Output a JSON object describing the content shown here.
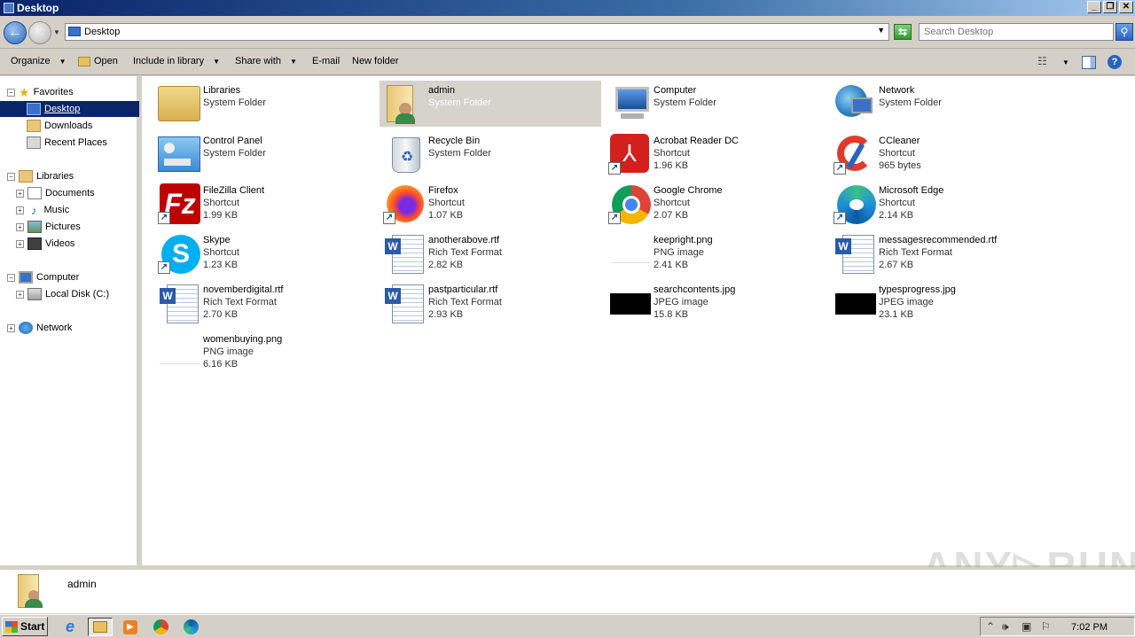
{
  "window": {
    "title": "Desktop"
  },
  "titlebar": {
    "minimize": "_",
    "maximize": "❐",
    "close": "✕"
  },
  "address": {
    "path": "Desktop",
    "search_placeholder": "Search Desktop"
  },
  "toolbar": {
    "organize": "Organize",
    "open": "Open",
    "include_in_library": "Include in library",
    "share_with": "Share with",
    "email": "E-mail",
    "new_folder": "New folder"
  },
  "nav": {
    "favorites": "Favorites",
    "desktop": "Desktop",
    "downloads": "Downloads",
    "recent_places": "Recent Places",
    "libraries": "Libraries",
    "documents": "Documents",
    "music": "Music",
    "pictures": "Pictures",
    "videos": "Videos",
    "computer": "Computer",
    "local_disk": "Local Disk (C:)",
    "network": "Network"
  },
  "items": [
    {
      "name": "Libraries",
      "type": "System Folder",
      "size": ""
    },
    {
      "name": "admin",
      "type": "System Folder",
      "size": ""
    },
    {
      "name": "Computer",
      "type": "System Folder",
      "size": ""
    },
    {
      "name": "Network",
      "type": "System Folder",
      "size": ""
    },
    {
      "name": "Control Panel",
      "type": "System Folder",
      "size": ""
    },
    {
      "name": "Recycle Bin",
      "type": "System Folder",
      "size": ""
    },
    {
      "name": "Acrobat Reader DC",
      "type": "Shortcut",
      "size": "1.96 KB"
    },
    {
      "name": "CCleaner",
      "type": "Shortcut",
      "size": "965 bytes"
    },
    {
      "name": "FileZilla Client",
      "type": "Shortcut",
      "size": "1.99 KB"
    },
    {
      "name": "Firefox",
      "type": "Shortcut",
      "size": "1.07 KB"
    },
    {
      "name": "Google Chrome",
      "type": "Shortcut",
      "size": "2.07 KB"
    },
    {
      "name": "Microsoft Edge",
      "type": "Shortcut",
      "size": "2.14 KB"
    },
    {
      "name": "Skype",
      "type": "Shortcut",
      "size": "1.23 KB"
    },
    {
      "name": "anotherabove.rtf",
      "type": "Rich Text Format",
      "size": "2.82 KB"
    },
    {
      "name": "keepright.png",
      "type": "PNG image",
      "size": "2.41 KB"
    },
    {
      "name": "messagesrecommended.rtf",
      "type": "Rich Text Format",
      "size": "2.67 KB"
    },
    {
      "name": "novemberdigital.rtf",
      "type": "Rich Text Format",
      "size": "2.70 KB"
    },
    {
      "name": "pastparticular.rtf",
      "type": "Rich Text Format",
      "size": "2.93 KB"
    },
    {
      "name": "searchcontents.jpg",
      "type": "JPEG image",
      "size": "15.8 KB"
    },
    {
      "name": "typesprogress.jpg",
      "type": "JPEG image",
      "size": "23.1 KB"
    },
    {
      "name": "womenbuying.png",
      "type": "PNG image",
      "size": "6.16 KB"
    }
  ],
  "details": {
    "name": "admin"
  },
  "watermark": "ANY▷RUN",
  "taskbar": {
    "start": "Start",
    "clock": "7:02 PM"
  }
}
